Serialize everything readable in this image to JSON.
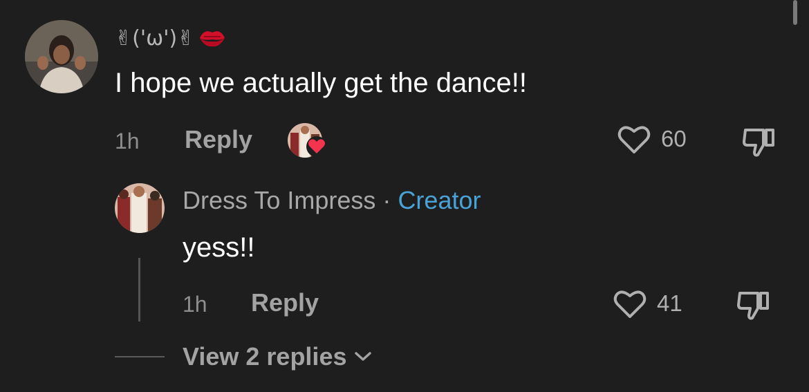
{
  "comment": {
    "username": "✌('ω')✌",
    "username_icon": "kiss-mark-icon",
    "text": "I hope we actually get the dance!!",
    "time": "1h",
    "reply_label": "Reply",
    "creator_liked_icon": "heart-badge-icon",
    "likes": "60",
    "like_icon": "heart-outline-icon",
    "dislike_icon": "thumbs-down-icon"
  },
  "reply": {
    "author": "Dress To Impress",
    "separator": "·",
    "badge": "Creator",
    "text": "yess!!",
    "time": "1h",
    "reply_label": "Reply",
    "likes": "41",
    "like_icon": "heart-outline-icon",
    "dislike_icon": "thumbs-down-icon"
  },
  "view_replies": {
    "label": "View 2 replies",
    "icon": "chevron-down-icon"
  },
  "colors": {
    "background": "#1e1e1e",
    "creator_badge": "#4aa3d6",
    "heart_badge": "#f2344f"
  }
}
